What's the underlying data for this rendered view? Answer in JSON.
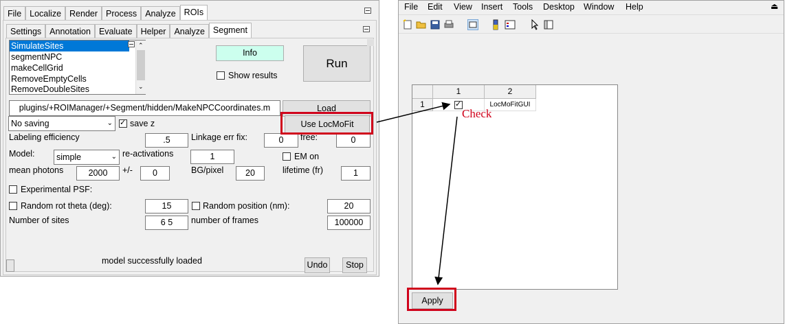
{
  "left": {
    "main_tabs": [
      "File",
      "Localize",
      "Render",
      "Process",
      "Analyze",
      "ROIs"
    ],
    "sub_tabs": [
      "Settings",
      "Annotation",
      "Evaluate",
      "Helper",
      "Analyze",
      "Segment"
    ],
    "script_list": [
      "SimulateSites",
      "segmentNPC",
      "makeCellGrid",
      "RemoveEmptyCells",
      "RemoveDoubleSites"
    ],
    "info_label": "Info",
    "run_label": "Run",
    "show_results_label": "Show results",
    "path_value": "plugins/+ROIManager/+Segment/hidden/MakeNPCCoordinates.m",
    "load_label": "Load",
    "saving_option": "No saving",
    "save_z_label": "save z",
    "use_locmofit_label": "Use LocMoFit",
    "labeling_efficiency_label": "Labeling efficiency",
    "labeling_efficiency_value": ".5",
    "linkage_err_label": "Linkage err fix:",
    "linkage_err_value": "0",
    "free_label": "free:",
    "free_value": "0",
    "model_label": "Model:",
    "model_value": "simple",
    "reactivations_label": "re-activations",
    "reactivations_value": "1",
    "em_on_label": "EM on",
    "mean_photons_label": "mean photons",
    "mean_photons_value": "2000",
    "plusminus_label": "+/-",
    "plusminus_value": "0",
    "bg_pixel_label": "BG/pixel",
    "bg_pixel_value": "20",
    "lifetime_label": "lifetime (fr)",
    "lifetime_value": "1",
    "experimental_psf_label": "Experimental PSF:",
    "random_rot_label": "Random rot theta (deg):",
    "random_rot_value": "15",
    "random_position_label": "Random position (nm):",
    "random_position_value": "20",
    "number_sites_label": "Number of sites",
    "number_sites_value": "6 5",
    "number_frames_label": "number of frames",
    "number_frames_value": "100000",
    "status_text": "model successfully loaded",
    "undo_label": "Undo",
    "stop_label": "Stop"
  },
  "right": {
    "menu": [
      "File",
      "Edit",
      "View",
      "Insert",
      "Tools",
      "Desktop",
      "Window",
      "Help"
    ],
    "table_col_headers": [
      "1",
      "2"
    ],
    "table_row_header": "1",
    "table_cell_text": "LocMoFitGUI",
    "apply_label": "Apply"
  },
  "annotation": {
    "check_label": "Check",
    "color": "#d0021b"
  }
}
